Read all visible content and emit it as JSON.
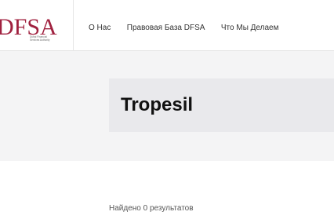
{
  "brand": {
    "logo_text": "DFSA",
    "tagline_line1": "Dubai Financial",
    "tagline_line2": "Services Authority",
    "color": "#a0213f"
  },
  "nav": {
    "items": [
      {
        "label": "О Нас"
      },
      {
        "label": "Правовая База DFSA"
      },
      {
        "label": "Что Мы Делаем"
      }
    ]
  },
  "main": {
    "title": "Tropesil",
    "results_text": "Найдено 0 результатов"
  }
}
